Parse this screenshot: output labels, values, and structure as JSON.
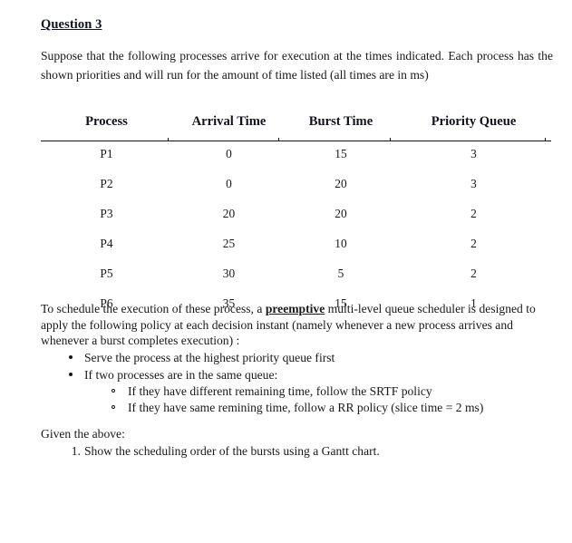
{
  "document": {
    "title": "Question 3",
    "intro_paragraph": "Suppose that the following processes arrive for execution at the times indicated. Each process has the shown priorities and will run for the amount of time listed (all times are in ms)",
    "table": {
      "headers": [
        "Process",
        "Arrival Time",
        "Burst Time",
        "Priority Queue"
      ],
      "rows": [
        {
          "process": "P1",
          "arrival": "0",
          "burst": "15",
          "priority": "3"
        },
        {
          "process": "P2",
          "arrival": "0",
          "burst": "20",
          "priority": "3"
        },
        {
          "process": "P3",
          "arrival": "20",
          "burst": "20",
          "priority": "2"
        },
        {
          "process": "P4",
          "arrival": "25",
          "burst": "10",
          "priority": "2"
        },
        {
          "process": "P5",
          "arrival": "30",
          "burst": "5",
          "priority": "2"
        },
        {
          "process": "P6",
          "arrival": "35",
          "burst": "15",
          "priority": "1"
        }
      ]
    },
    "policy_paragraph": {
      "part1": "To schedule the execution of these process, a ",
      "emphasis": "preemptive",
      "part2": " multi-level queue scheduler is designed to apply the following policy at each decision instant (namely whenever a new process arrives and whenever a burst completes execution) :"
    },
    "bullets": [
      "Serve the process at the highest priority queue first",
      "If two processes are in the same queue:"
    ],
    "sub_bullets": [
      "If they have different remaining time, follow the SRTF policy",
      "If they have same remining time, follow a RR policy (slice time = 2 ms)"
    ],
    "given_label": "Given the above:",
    "numbered_items": [
      {
        "number": "1.",
        "text": "Show the scheduling order of the bursts using a Gantt chart."
      }
    ],
    "colors": {
      "text": "#181818",
      "heading": "#11131c",
      "rule": "#151515",
      "background": "#ffffff"
    }
  }
}
